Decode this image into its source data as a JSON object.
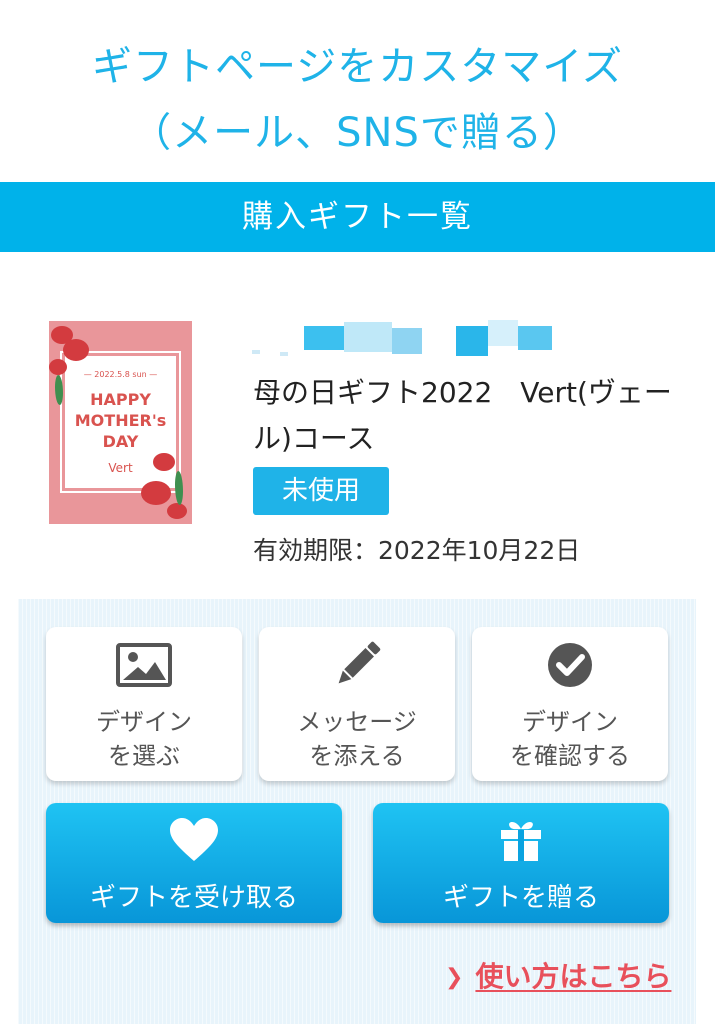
{
  "header": {
    "title_line1": "ギフトページをカスタマイズ",
    "title_line2": "（メール、SNSで贈る）"
  },
  "section": {
    "title": "購入ギフト一覧"
  },
  "gift": {
    "thumbnail": {
      "date": "— 2022.5.8 sun —",
      "line1": "HAPPY",
      "line2": "MOTHER's",
      "line3": "DAY",
      "brand": "Vert"
    },
    "name": "母の日ギフト2022　Vert(ヴェール)コース",
    "status_badge": "未使用",
    "expiry": "有効期限：2022年10月22日"
  },
  "actions": {
    "choose_design": {
      "line1": "デザイン",
      "line2": "を選ぶ",
      "icon": "image-icon"
    },
    "add_message": {
      "line1": "メッセージ",
      "line2": "を添える",
      "icon": "pencil-icon"
    },
    "confirm_design": {
      "line1": "デザイン",
      "line2": "を確認する",
      "icon": "check-circle-icon"
    },
    "receive_gift": {
      "label": "ギフトを受け取る",
      "icon": "heart-icon"
    },
    "send_gift": {
      "label": "ギフトを贈る",
      "icon": "gift-icon"
    }
  },
  "help_link": {
    "label": "使い方はこちら"
  },
  "colors": {
    "accent": "#00b2ea",
    "title_text": "#1fb3e8",
    "link": "#e8505b",
    "panel_bg": "#e8f4fb"
  }
}
